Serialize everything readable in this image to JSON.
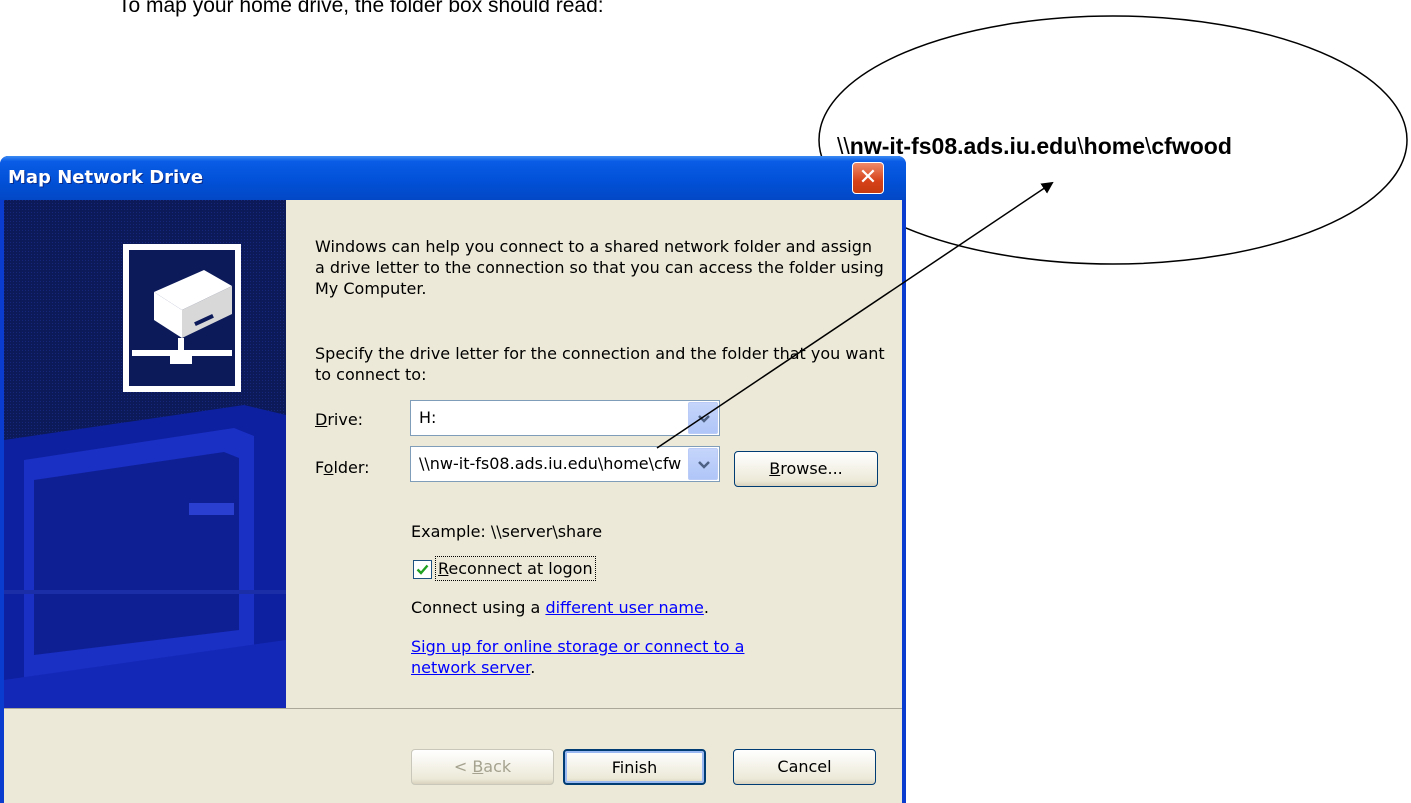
{
  "instruction": "To map your home drive, the folder box should read:",
  "callout": {
    "prefix": "\\\\",
    "server": "nw-it-fs08.ads.iu.edu",
    "sep1": "\\",
    "share": "home",
    "sep2": "\\",
    "user": "cfwood"
  },
  "dialog": {
    "title": "Map Network Drive",
    "close_icon": "close-icon",
    "intro": "Windows can help you connect to a shared network folder and assign a drive letter to the connection so that you can access the folder using My Computer.",
    "specify": "Specify the drive letter for the connection and the folder that you want to connect to:",
    "drive_label_pre": "",
    "drive_label_acc": "D",
    "drive_label_post": "rive:",
    "drive_value": "H:",
    "folder_label_pre": "F",
    "folder_label_acc": "o",
    "folder_label_post": "lder:",
    "folder_value": "\\\\nw-it-fs08.ads.iu.edu\\home\\cfwood",
    "browse_acc": "B",
    "browse_post": "rowse...",
    "example": "Example: \\\\server\\share",
    "reconnect_checked": true,
    "reconnect_acc": "R",
    "reconnect_post": "econnect at logon",
    "connect_using_pre": "Connect using a ",
    "connect_using_link": "different user name",
    "connect_using_post": ".",
    "signup_link_1": "Sign up for online storage or connect to a",
    "signup_link_2": "network server",
    "signup_post": ".",
    "back_pre": "< ",
    "back_acc": "B",
    "back_post": "ack",
    "finish": "Finish",
    "cancel": "Cancel"
  },
  "colors": {
    "titlebar": "#0251d8",
    "panel": "#0c1a5a",
    "dialog_bg": "#ece9d8",
    "link": "#0000ff",
    "close": "#d64219"
  }
}
